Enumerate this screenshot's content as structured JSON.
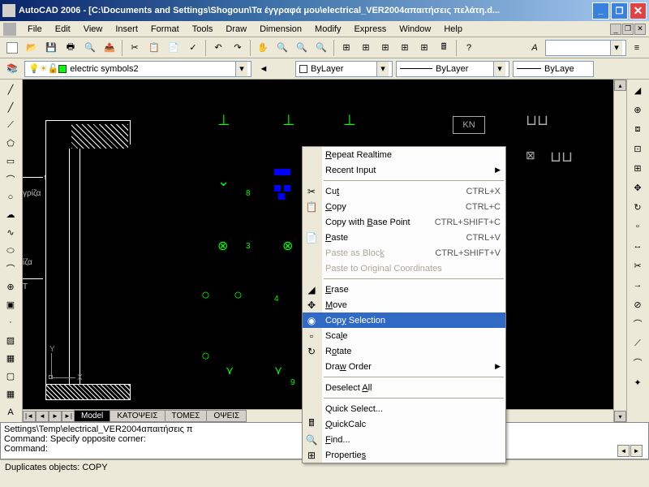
{
  "window": {
    "title": "AutoCAD 2006 - [C:\\Documents and Settings\\Shogoun\\Τα έγγραφά μου\\electrical_VER2004απαιτήσεις πελάτη.d..."
  },
  "menus": [
    "File",
    "Edit",
    "View",
    "Insert",
    "Format",
    "Tools",
    "Draw",
    "Dimension",
    "Modify",
    "Express",
    "Window",
    "Help"
  ],
  "layer": {
    "current": "electric symbols2",
    "bylayer": "ByLayer",
    "linetype": "ByLayer",
    "lineweight": "ByLaye"
  },
  "tabs": {
    "model": "Model",
    "others": [
      "ΚΑΤΟΨΕΙΣ",
      "ΤΟΜΕΣ",
      "ΟΨΕΙΣ"
    ]
  },
  "command": {
    "line1": "Settings\\Temp\\electrical_VER2004απαιτήσεις π",
    "line2": "Command: Specify opposite corner:",
    "prompt": "Command:"
  },
  "statusbar": "Duplicates objects:  COPY",
  "context_menu": {
    "items": [
      {
        "label": "Repeat Realtime",
        "accel": "R",
        "icon": ""
      },
      {
        "label": "Recent Input",
        "accel": "",
        "submenu": true
      },
      {
        "sep": true
      },
      {
        "label": "Cut",
        "accel": "t",
        "shortcut": "CTRL+X",
        "icon": "✂"
      },
      {
        "label": "Copy",
        "accel": "C",
        "shortcut": "CTRL+C",
        "icon": "📋"
      },
      {
        "label": "Copy with Base Point",
        "accel": "B",
        "shortcut": "CTRL+SHIFT+C"
      },
      {
        "label": "Paste",
        "accel": "P",
        "shortcut": "CTRL+V",
        "icon": "📄"
      },
      {
        "label": "Paste as Block",
        "accel": "k",
        "shortcut": "CTRL+SHIFT+V",
        "disabled": true
      },
      {
        "label": "Paste to Original Coordinates",
        "accel": "",
        "disabled": true
      },
      {
        "sep": true
      },
      {
        "label": "Erase",
        "accel": "E",
        "icon": "◢"
      },
      {
        "label": "Move",
        "accel": "M",
        "icon": "✥"
      },
      {
        "label": "Copy Selection",
        "accel": "y",
        "icon": "◉",
        "highlighted": true
      },
      {
        "label": "Scale",
        "accel": "l",
        "icon": "▫"
      },
      {
        "label": "Rotate",
        "accel": "o",
        "icon": "↻"
      },
      {
        "label": "Draw Order",
        "accel": "w",
        "submenu": true
      },
      {
        "sep": true
      },
      {
        "label": "Deselect All",
        "accel": "A"
      },
      {
        "sep": true
      },
      {
        "label": "Quick Select...",
        "accel": ""
      },
      {
        "label": "QuickCalc",
        "accel": "Q",
        "icon": "🖩"
      },
      {
        "label": "Find...",
        "accel": "F",
        "icon": "🔍"
      },
      {
        "label": "Properties",
        "accel": "s",
        "icon": "⊞"
      }
    ]
  },
  "drawing": {
    "label_griza": "γρίζα",
    "label_iza": "ίζα",
    "label_T": "T",
    "label_Y": "Y",
    "label_X": "X",
    "label_KN": "KN",
    "num_8": "8",
    "num_3": "3",
    "num_4": "4",
    "num_9": "9"
  }
}
